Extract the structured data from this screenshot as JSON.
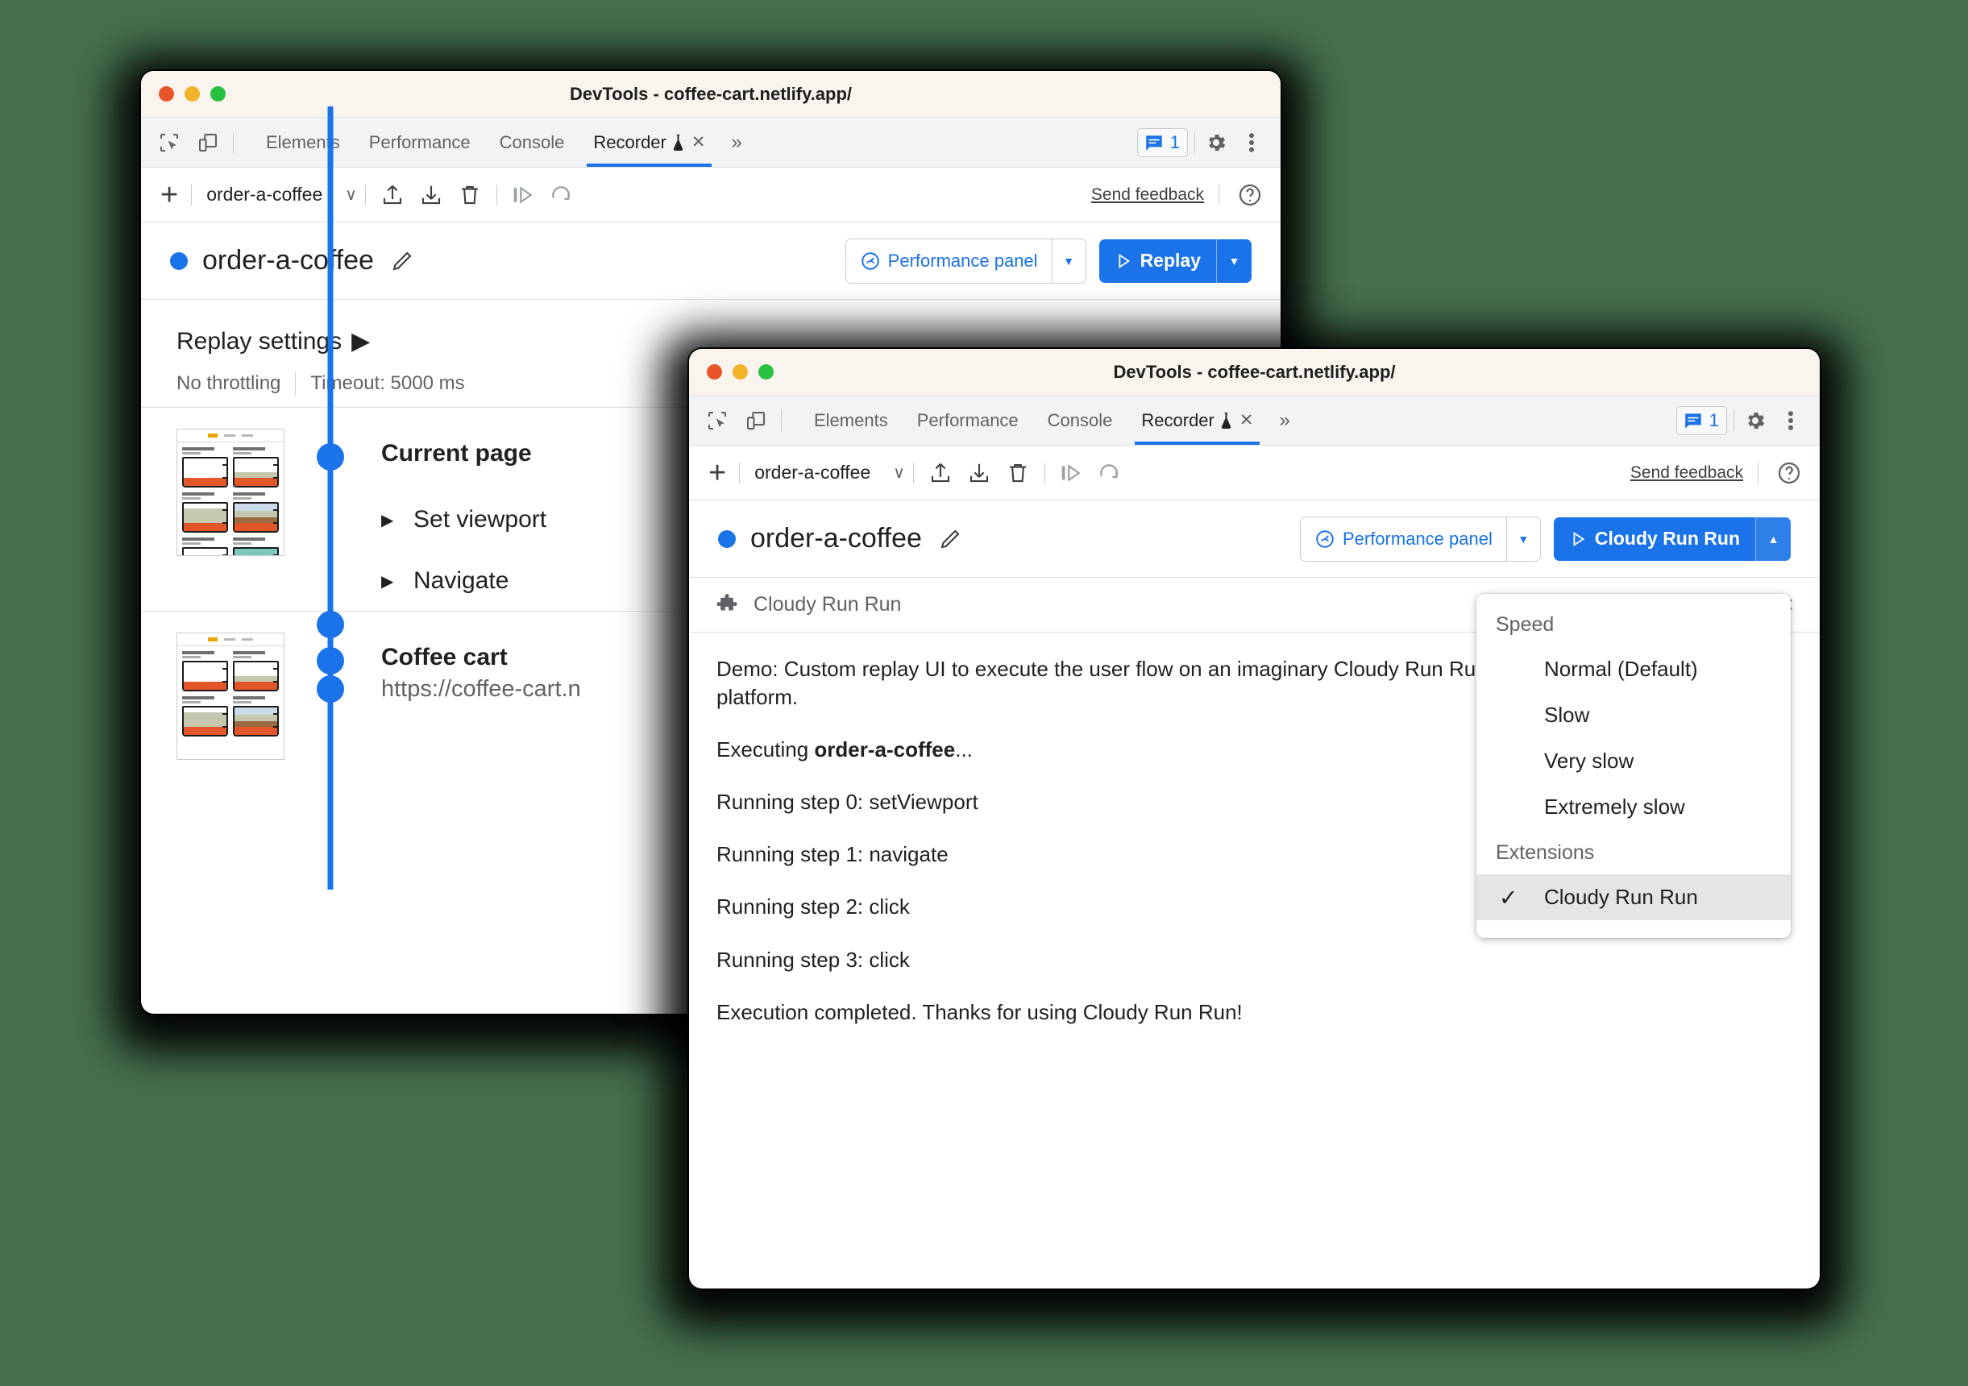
{
  "background_color": "#456f4e",
  "windows": {
    "back": {
      "title": "DevTools - coffee-cart.netlify.app/",
      "tabs": [
        {
          "label": "Elements",
          "active": false
        },
        {
          "label": "Performance",
          "active": false
        },
        {
          "label": "Console",
          "active": false
        },
        {
          "label": "Recorder",
          "active": true,
          "flask": true,
          "closable": true
        }
      ],
      "more_tabs_label": "»",
      "feedback_badge_count": "1",
      "toolbar": {
        "add_label": "+",
        "recording_name": "order-a-coffee",
        "dropdown_chevron": "∨",
        "send_feedback": "Send feedback"
      },
      "header": {
        "title": "order-a-coffee",
        "performance_button": "Performance panel",
        "replay_button": "Replay"
      },
      "replay_settings": {
        "title": "Replay settings",
        "throttling": "No throttling",
        "timeout": "Timeout: 5000 ms"
      },
      "steps": [
        {
          "title": "Current page",
          "url": "",
          "substeps": [
            "Set viewport",
            "Navigate"
          ]
        },
        {
          "title": "Coffee cart",
          "url": "https://coffee-cart.n",
          "substeps": []
        }
      ]
    },
    "front": {
      "title": "DevTools - coffee-cart.netlify.app/",
      "tabs": [
        {
          "label": "Elements",
          "active": false
        },
        {
          "label": "Performance",
          "active": false
        },
        {
          "label": "Console",
          "active": false
        },
        {
          "label": "Recorder",
          "active": true,
          "flask": true,
          "closable": true
        }
      ],
      "more_tabs_label": "»",
      "feedback_badge_count": "1",
      "toolbar": {
        "add_label": "+",
        "recording_name": "order-a-coffee",
        "dropdown_chevron": "∨",
        "send_feedback": "Send feedback"
      },
      "header": {
        "title": "order-a-coffee",
        "performance_button": "Performance panel",
        "replay_button": "Cloudy Run Run"
      },
      "extension_panel": {
        "name": "Cloudy Run Run",
        "close_label": "×",
        "log": [
          {
            "text": "Demo: Custom replay UI to execute the user flow on an imaginary Cloudy Run Run platform.",
            "bold": ""
          },
          {
            "text": "Executing order-a-coffee...",
            "bold": "order-a-coffee"
          },
          {
            "text": "Running step 0: setViewport",
            "bold": ""
          },
          {
            "text": "Running step 1: navigate",
            "bold": ""
          },
          {
            "text": "Running step 2: click",
            "bold": ""
          },
          {
            "text": "Running step 3: click",
            "bold": ""
          },
          {
            "text": "Execution completed. Thanks for using Cloudy Run Run!",
            "bold": ""
          }
        ]
      },
      "replay_menu": {
        "speed_group": "Speed",
        "speed_options": [
          "Normal (Default)",
          "Slow",
          "Very slow",
          "Extremely slow"
        ],
        "extensions_group": "Extensions",
        "extension_options": [
          {
            "label": "Cloudy Run Run",
            "checked": true
          }
        ]
      }
    }
  },
  "colors": {
    "accent_blue": "#1a73e8",
    "titlebar": "#faf4ee",
    "tabbar": "#f1f3f4",
    "text_primary": "#202124",
    "text_secondary": "#5f6368"
  }
}
